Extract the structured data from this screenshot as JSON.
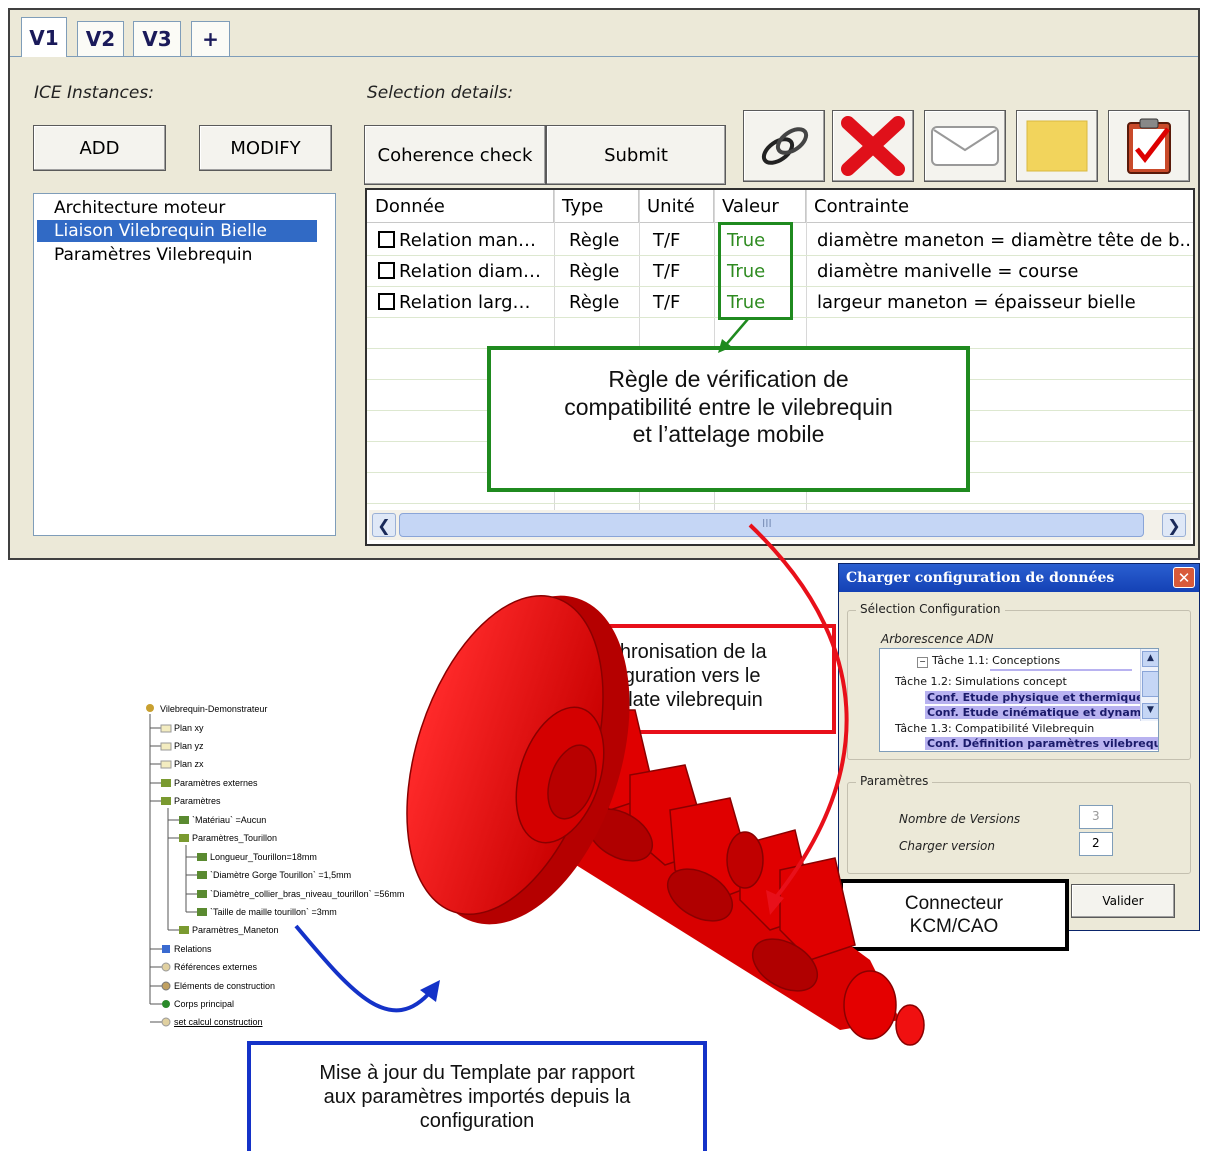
{
  "tabs": [
    "V1",
    "V2",
    "V3",
    "+"
  ],
  "left_panel": {
    "label": "ICE Instances:",
    "add_label": "ADD",
    "modify_label": "MODIFY",
    "instances": [
      "Architecture moteur",
      "Liaison Vilebrequin Bielle",
      "Paramètres Vilebrequin"
    ],
    "selected_index": 1
  },
  "right_panel": {
    "label": "Selection details:",
    "coherence_label": "Coherence check",
    "submit_label": "Submit",
    "toolbar_icons": [
      "link-icon",
      "delete-icon",
      "mail-icon",
      "note-icon",
      "checklist-icon"
    ]
  },
  "table": {
    "columns": [
      "Donnée",
      "Type",
      "Unité",
      "Valeur",
      "Contrainte"
    ],
    "rows": [
      {
        "donnee": "Relation man…",
        "type": "Règle",
        "unite": "T/F",
        "valeur": "True",
        "contrainte": "diamètre maneton = diamètre tête de b.."
      },
      {
        "donnee": "Relation diam…",
        "type": "Règle",
        "unite": "T/F",
        "valeur": "True",
        "contrainte": "diamètre manivelle = course"
      },
      {
        "donnee": "Relation larg…",
        "type": "Règle",
        "unite": "T/F",
        "valeur": "True",
        "contrainte": "largeur maneton = épaisseur bielle"
      }
    ],
    "scroll_grip": "III"
  },
  "callouts": {
    "green": [
      "Règle de vérification de",
      "compatibilité entre le vilebrequin",
      "et l’attelage mobile"
    ],
    "red": [
      "Synchronisation de la",
      "configuration vers le",
      "Template vilebrequin"
    ],
    "black": [
      "Connecteur",
      "KCM/CAO"
    ],
    "blue": [
      "Mise à jour du Template par rapport",
      "aux paramètres importés depuis la",
      "configuration"
    ]
  },
  "dialog": {
    "title": "Charger configuration de données",
    "group_config": "Sélection Configuration",
    "tree_label": "Arborescence ADN",
    "tree": [
      {
        "text": "Tâche 1.1: Conceptions",
        "highlight": false
      },
      {
        "text": "Tâche 1.2: Simulations concept",
        "highlight": false
      },
      {
        "text": "Conf. Etude physique et thermique",
        "highlight": true
      },
      {
        "text": "Conf. Etude cinématique et dynamique",
        "highlight": true
      },
      {
        "text": "Tâche 1.3: Compatibilité Vilebrequin",
        "highlight": false
      },
      {
        "text": "Conf. Définition paramètres vilebrequi",
        "highlight": true
      }
    ],
    "group_params": "Paramètres",
    "versions_label": "Nombre de Versions",
    "versions_value": "3",
    "load_label": "Charger version",
    "load_value": "2",
    "validate_label": "Valider"
  },
  "spec_tree": [
    "Vilebrequin-Demonstrateur",
    "Plan xy",
    "Plan yz",
    "Plan zx",
    "Paramètres externes",
    "Paramètres",
    "`Matériau` =Aucun",
    "Paramètres_Tourillon",
    "Longueur_Tourillon=18mm",
    "`Diamètre Gorge Tourillon` =1,5mm",
    "`Diamètre_collier_bras_niveau_tourillon` =56mm",
    "`Taille de maille tourillon` =3mm",
    "Paramètres_Maneton",
    "Relations",
    "Références externes",
    "Eléments de construction",
    "Corps principal",
    "set calcul construction"
  ],
  "colors": {
    "accent_green": "#1f8a1f",
    "accent_red": "#e8101a",
    "accent_blue": "#1432c8",
    "selection": "#316ac5",
    "crankshaft": "#e00000"
  }
}
